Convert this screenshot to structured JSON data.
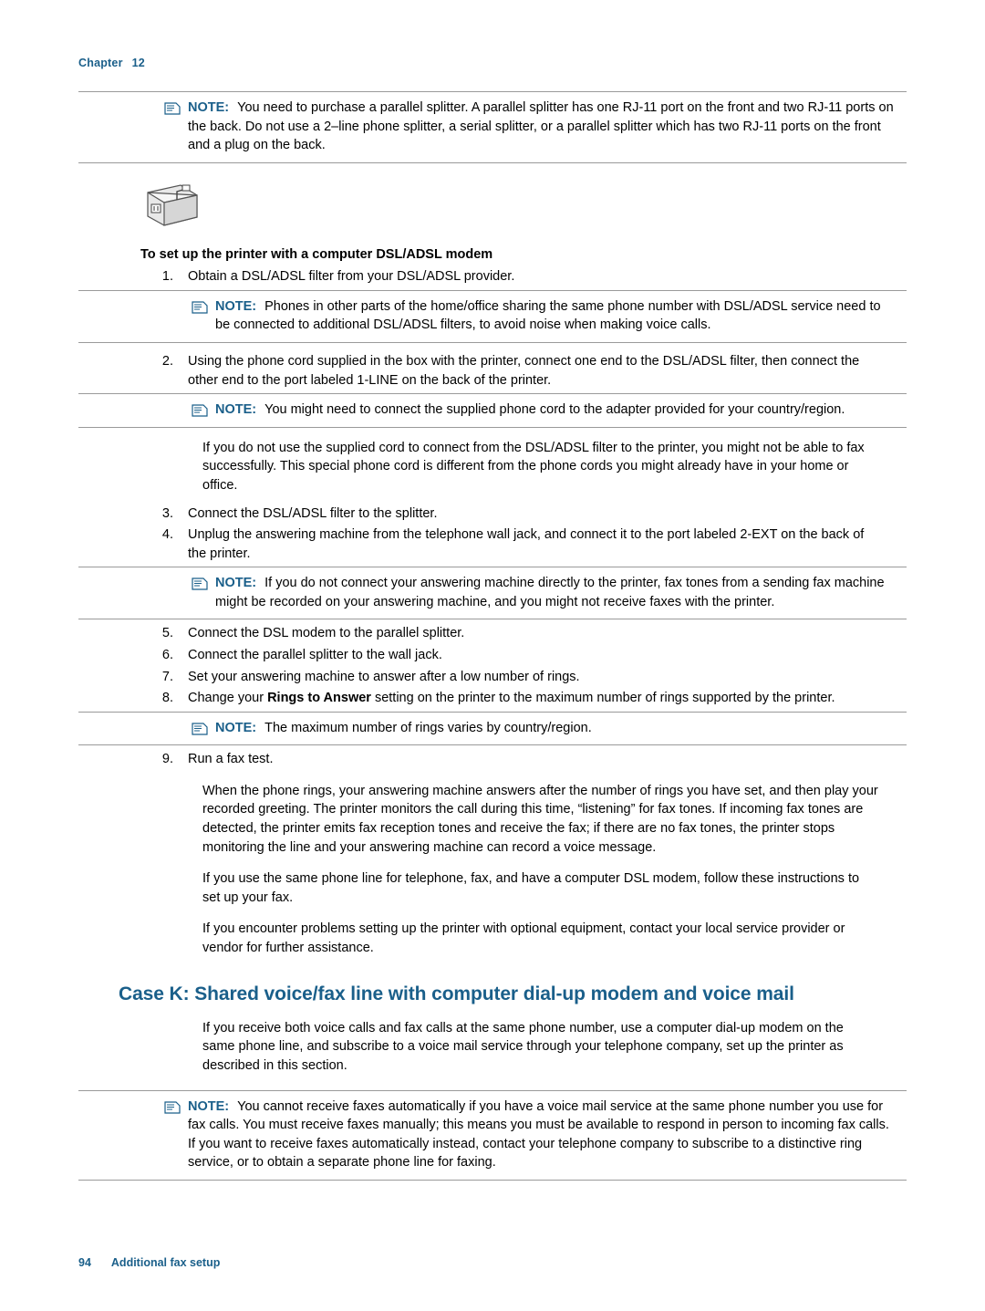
{
  "header": {
    "chapter_label": "Chapter",
    "chapter_number": "12"
  },
  "notes": {
    "label": "NOTE:",
    "note1": "You need to purchase a parallel splitter. A parallel splitter has one RJ-11 port on the front and two RJ-11 ports on the back. Do not use a 2–line phone splitter, a serial splitter, or a parallel splitter which has two RJ-11 ports on the front and a plug on the back.",
    "note2": "Phones in other parts of the home/office sharing the same phone number with DSL/ADSL service need to be connected to additional DSL/ADSL filters, to avoid noise when making voice calls.",
    "note3": "You might need to connect the supplied phone cord to the adapter provided for your country/region.",
    "note4": "If you do not connect your answering machine directly to the printer, fax tones from a sending fax machine might be recorded on your answering machine, and you might not receive faxes with the printer.",
    "note5": "The maximum number of rings varies by country/region.",
    "note6": "You cannot receive faxes automatically if you have a voice mail service at the same phone number you use for fax calls. You must receive faxes manually; this means you must be available to respond in person to incoming fax calls. If you want to receive faxes automatically instead, contact your telephone company to subscribe to a distinctive ring service, or to obtain a separate phone line for faxing."
  },
  "section": {
    "procedure_title": "To set up the printer with a computer DSL/ADSL modem",
    "steps": [
      {
        "num": "1.",
        "text": "Obtain a DSL/ADSL filter from your DSL/ADSL provider."
      },
      {
        "num": "2.",
        "text": "Using the phone cord supplied in the box with the printer, connect one end to the DSL/ADSL filter, then connect the other end to the port labeled 1-LINE on the back of the printer."
      },
      {
        "num": "3.",
        "text": "Connect the DSL/ADSL filter to the splitter."
      },
      {
        "num": "4.",
        "text": "Unplug the answering machine from the telephone wall jack, and connect it to the port labeled 2-EXT on the back of the printer."
      },
      {
        "num": "5.",
        "text": "Connect the DSL modem to the parallel splitter."
      },
      {
        "num": "6.",
        "text": "Connect the parallel splitter to the wall jack."
      },
      {
        "num": "7.",
        "text": "Set your answering machine to answer after a low number of rings."
      },
      {
        "num": "8.",
        "text": "Change your Rings to Answer setting on the printer to the maximum number of rings supported by the printer."
      },
      {
        "num": "9.",
        "text": "Run a fax test."
      }
    ],
    "step8_bold_fragment": "Rings to Answer",
    "step2_followup": "If you do not use the supplied cord to connect from the DSL/ADSL filter to the printer, you might not be able to fax successfully. This special phone cord is different from the phone cords you might already have in your home or office.",
    "para_after_steps": "When the phone rings, your answering machine answers after the number of rings you have set, and then play your recorded greeting. The printer monitors the call during this time, “listening” for fax tones. If incoming fax tones are detected, the printer emits fax reception tones and receive the fax; if there are no fax tones, the printer stops monitoring the line and your answering machine can record a voice message.",
    "para_same_line": "If you use the same phone line for telephone, fax, and have a computer DSL modem, follow these instructions to set up your fax.",
    "para_problems": "If you encounter problems setting up the printer with optional equipment, contact your local service provider or vendor for further assistance."
  },
  "case_k": {
    "heading": "Case K: Shared voice/fax line with computer dial-up modem and voice mail",
    "intro": "If you receive both voice calls and fax calls at the same phone number, use a computer dial-up modem on the same phone line, and subscribe to a voice mail service through your telephone company, set up the printer as described in this section."
  },
  "footer": {
    "page_number": "94",
    "label": "Additional fax setup"
  },
  "colors": {
    "accent": "#1a5f8a",
    "rule": "#9a9a9a"
  }
}
